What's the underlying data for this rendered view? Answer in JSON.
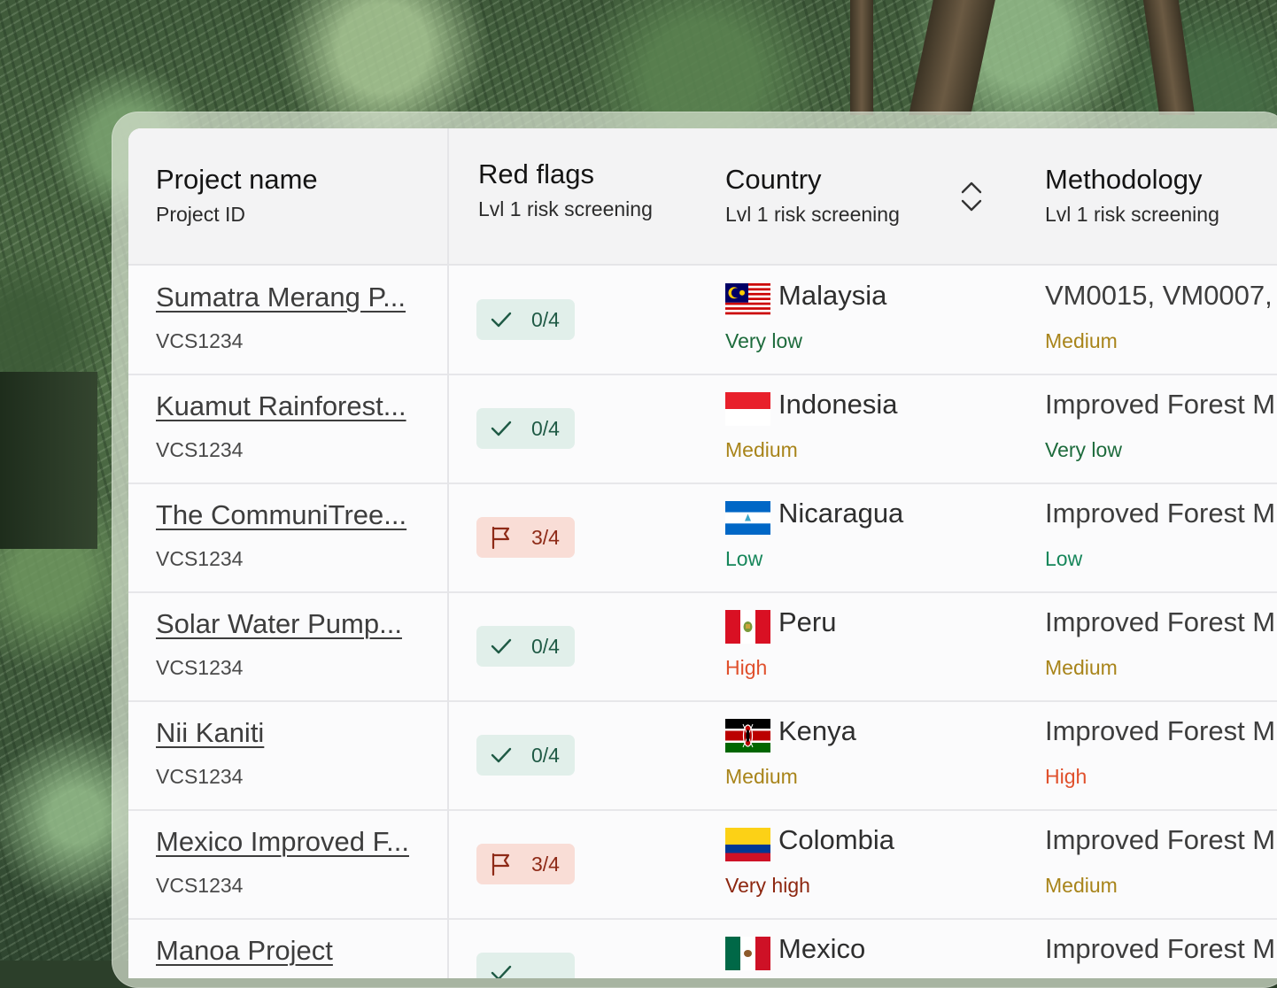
{
  "colors": {
    "very_low": "#1d6b3c",
    "low": "#16865a",
    "medium": "#a8841a",
    "high": "#e0502c",
    "very_high": "#8d2710"
  },
  "header": {
    "project_name": "Project name",
    "project_id": "Project ID",
    "red_flags": "Red flags",
    "red_flags_sub": "Lvl 1 risk screening",
    "country": "Country",
    "country_sub": "Lvl 1 risk screening",
    "country_sort_icon": "sort-icon",
    "methodology": "Methodology",
    "methodology_sub": "Lvl 1 risk screening"
  },
  "rows": [
    {
      "name": "Sumatra Merang P...",
      "id": "VCS1234",
      "badge_type": "ok",
      "badge_icon": "check-icon",
      "flags": "0/4",
      "flag": "malaysia",
      "country": "Malaysia",
      "country_risk": "Very low",
      "country_risk_level": "very_low",
      "methodology": "VM0015, VM0007,",
      "methodology_risk": "Medium",
      "methodology_risk_level": "medium"
    },
    {
      "name": "Kuamut Rainforest...",
      "id": "VCS1234",
      "badge_type": "ok",
      "badge_icon": "check-icon",
      "flags": "0/4",
      "flag": "indonesia",
      "country": "Indonesia",
      "country_risk": "Medium",
      "country_risk_level": "medium",
      "methodology": "Improved Forest M",
      "methodology_risk": "Very low",
      "methodology_risk_level": "very_low"
    },
    {
      "name": "The CommuniTree...",
      "id": "VCS1234",
      "badge_type": "flag",
      "badge_icon": "flag-icon",
      "flags": "3/4",
      "flag": "nicaragua",
      "country": "Nicaragua",
      "country_risk": "Low",
      "country_risk_level": "low",
      "methodology": "Improved Forest M",
      "methodology_risk": "Low",
      "methodology_risk_level": "low"
    },
    {
      "name": "Solar Water Pump...",
      "id": "VCS1234",
      "badge_type": "ok",
      "badge_icon": "check-icon",
      "flags": "0/4",
      "flag": "peru",
      "country": "Peru",
      "country_risk": "High",
      "country_risk_level": "high",
      "methodology": "Improved Forest M",
      "methodology_risk": "Medium",
      "methodology_risk_level": "medium"
    },
    {
      "name": "Nii Kaniti",
      "id": "VCS1234",
      "badge_type": "ok",
      "badge_icon": "check-icon",
      "flags": "0/4",
      "flag": "kenya",
      "country": "Kenya",
      "country_risk": "Medium",
      "country_risk_level": "medium",
      "methodology": "Improved Forest M",
      "methodology_risk": "High",
      "methodology_risk_level": "high"
    },
    {
      "name": "Mexico Improved F...",
      "id": "VCS1234",
      "badge_type": "flag",
      "badge_icon": "flag-icon",
      "flags": "3/4",
      "flag": "colombia",
      "country": "Colombia",
      "country_risk": "Very high",
      "country_risk_level": "very_high",
      "methodology": "Improved Forest M",
      "methodology_risk": "Medium",
      "methodology_risk_level": "medium"
    },
    {
      "name": "Manoa Project",
      "id": "",
      "badge_type": "ok",
      "badge_icon": "check-icon",
      "flags": "",
      "flag": "mexico",
      "country": "Mexico",
      "country_risk": "",
      "country_risk_level": "",
      "methodology": "Improved Forest M",
      "methodology_risk": "",
      "methodology_risk_level": ""
    }
  ]
}
